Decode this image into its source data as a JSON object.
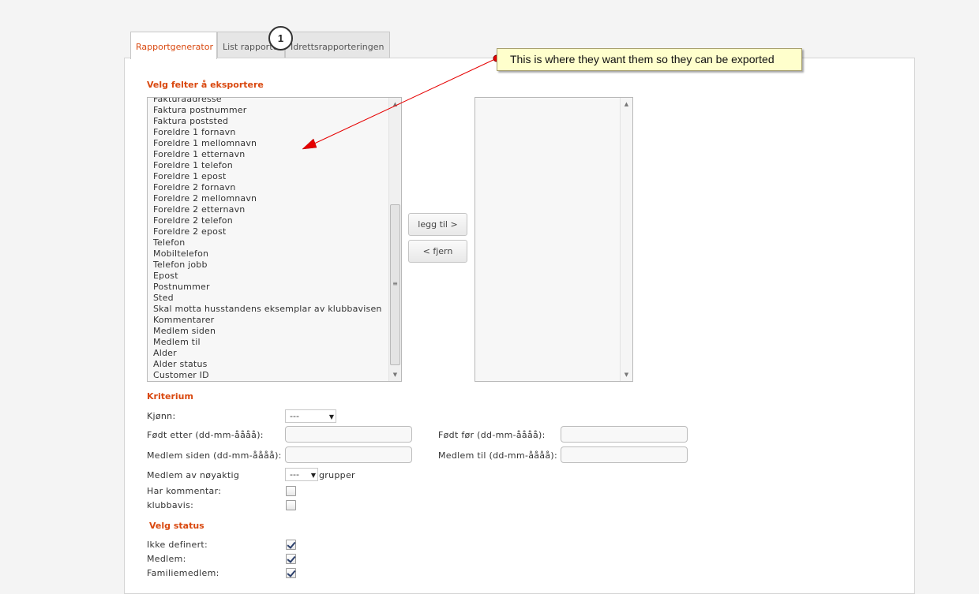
{
  "tabs": [
    {
      "label": "Rapportgenerator"
    },
    {
      "label": "List rapporter"
    },
    {
      "label": "Idrettsrapporteringen"
    }
  ],
  "step_badge": "1",
  "callout": "This is where they want them so they can be exported",
  "export": {
    "title": "Velg felter å eksportere",
    "available_fields": [
      "Fakturaadresse",
      "Faktura postnummer",
      "Faktura poststed",
      "Foreldre 1 fornavn",
      "Foreldre 1 mellomnavn",
      "Foreldre 1 etternavn",
      "Foreldre 1 telefon",
      "Foreldre 1 epost",
      "Foreldre 2 fornavn",
      "Foreldre 2 mellomnavn",
      "Foreldre 2 etternavn",
      "Foreldre 2 telefon",
      "Foreldre 2 epost",
      "Telefon",
      "Mobiltelefon",
      "Telefon jobb",
      "Epost",
      "Postnummer",
      "Sted",
      "Skal motta husstandens eksemplar av klubbavisen",
      "Kommentarer",
      "Medlem siden",
      "Medlem til",
      "Alder",
      "Alder status",
      "Customer ID"
    ],
    "add_label": "legg til >",
    "remove_label": "< fjern"
  },
  "criteria": {
    "title": "Kriterium",
    "gender_label": "Kjønn:",
    "gender_value": "---",
    "born_after_label": "Født etter (dd-mm-åååå):",
    "born_before_label": "Født før (dd-mm-åååå):",
    "member_since_label": "Medlem siden (dd-mm-åååå):",
    "member_until_label": "Medlem til (dd-mm-åååå):",
    "member_exact_label": "Medlem av nøyaktig",
    "member_exact_value": "---",
    "groups_label": "grupper",
    "has_comment_label": "Har kommentar:",
    "club_paper_label": "klubbavis:"
  },
  "status": {
    "title": "Velg status",
    "options": [
      {
        "label": "Ikke definert:",
        "checked": true
      },
      {
        "label": "Medlem:",
        "checked": true
      },
      {
        "label": "Familiemedlem:",
        "checked": true
      }
    ]
  },
  "colors": {
    "accent": "#d9480f",
    "callout_bg": "#ffffcc",
    "arrow": "#e60000"
  }
}
